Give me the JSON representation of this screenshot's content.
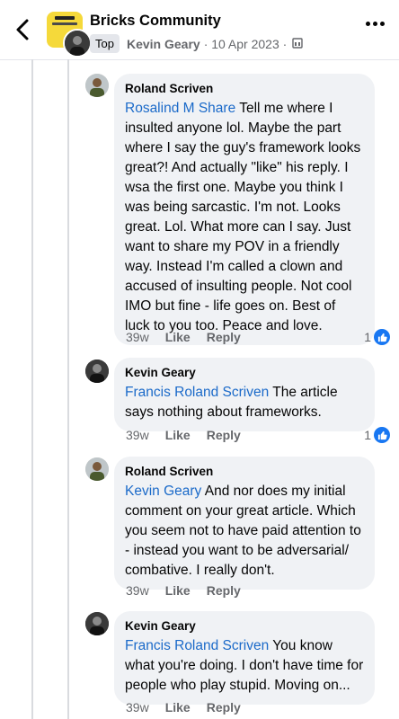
{
  "header": {
    "title": "Bricks Community",
    "badge": "Top",
    "author": "Kevin Geary",
    "date": "· 10 Apr 2023 ·"
  },
  "comments": [
    {
      "name": "Roland Scriven",
      "mention": "Rosalind M Share",
      "text": " Tell me where I insulted anyone lol. Maybe the part where I say the guy's framework looks great?! And actually \"like\" his reply. I wsa the first one. Maybe you think I was being sarcastic. I'm not. Looks great. Lol. What more can I say. Just want to share my POV in a friendly way. Instead I'm called a clown and accused of insulting people. Not cool IMO but fine - life goes on. Best of luck to you too. Peace and love.",
      "time": "39w",
      "like_label": "Like",
      "reply_label": "Reply",
      "likes": "1"
    },
    {
      "name": "Kevin Geary",
      "mention": "Francis Roland Scriven",
      "text": " The article says nothing about frameworks.",
      "time": "39w",
      "like_label": "Like",
      "reply_label": "Reply",
      "likes": "1"
    },
    {
      "name": "Roland Scriven",
      "mention": "Kevin Geary",
      "text": " And nor does my initial comment on your great article. Which you seem not to have paid attention to - instead you want to be adversarial/ combative. I really don't.",
      "time": "39w",
      "like_label": "Like",
      "reply_label": "Reply"
    },
    {
      "name": "Kevin Geary",
      "mention": "Francis Roland Scriven",
      "text": " You know what you're doing. I don't have time for people who play stupid. Moving on...",
      "time": "39w",
      "like_label": "Like",
      "reply_label": "Reply"
    }
  ],
  "colors": {
    "mention": "#1b6ac9",
    "like": "#1877f2",
    "bubble": "#f0f2f5"
  }
}
